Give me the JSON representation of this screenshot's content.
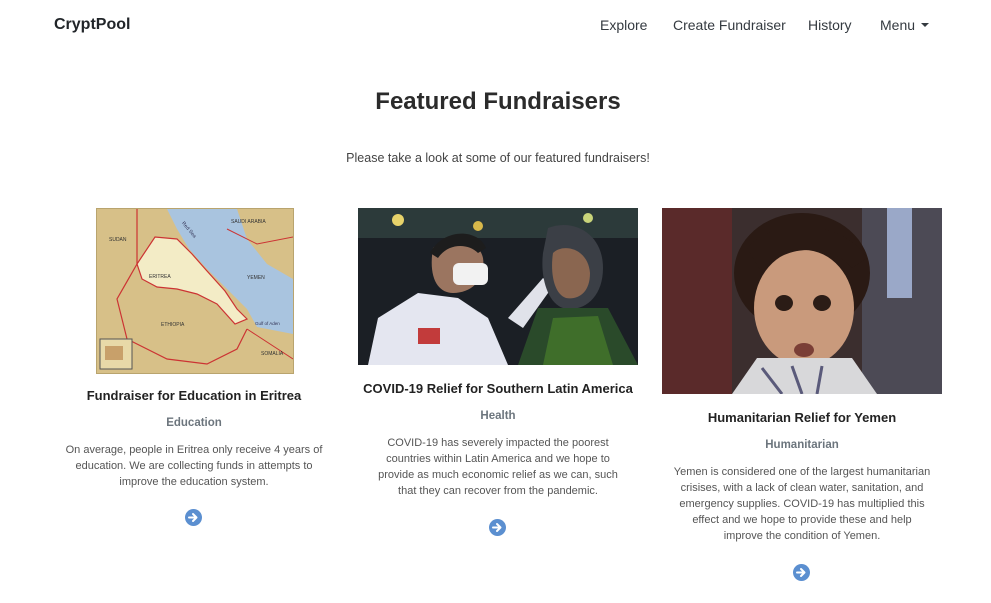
{
  "navbar": {
    "brand": "CryptPool",
    "items": [
      {
        "label": "Explore"
      },
      {
        "label": "Create Fundraiser"
      },
      {
        "label": "History"
      },
      {
        "label": "Menu"
      }
    ]
  },
  "header": {
    "title": "Featured Fundraisers",
    "subtitle": "Please take a look at some of our featured fundraisers!"
  },
  "cards": [
    {
      "image_icon": "eritrea-map-image",
      "map_labels": [
        "SUDAN",
        "ERITREA",
        "SAUDI ARABIA",
        "YEMEN",
        "ETHIOPIA",
        "SOMALIA",
        "Red Sea",
        "Gulf of Aden"
      ],
      "title": "Fundraiser for Education in Eritrea",
      "category": "Education",
      "description_lines": [
        "On average, people in Eritrea only receive 4 years of",
        "education. We are collecting funds in attempts to",
        "improve the education system."
      ],
      "button_icon": "arrow-right-circle-icon"
    },
    {
      "image_icon": "covid-test-photo",
      "title": "COVID-19 Relief for Southern Latin America",
      "category": "Health",
      "description_lines": [
        "COVID-19 has severely impacted the poorest",
        "countries within Latin America and we hope to",
        "provide as much economic relief as we can, such",
        "that they can recover from the pandemic."
      ],
      "button_icon": "arrow-right-circle-icon"
    },
    {
      "image_icon": "yemen-child-photo",
      "title": "Humanitarian Relief for Yemen",
      "category": "Humanitarian",
      "description_lines": [
        "Yemen is considered one of the largest humanitarian",
        "crisises, with a lack of clean water, sanitation, and",
        "emergency supplies. COVID-19 has multiplied this",
        "effect and we hope to provide these and help",
        "improve the condition of Yemen."
      ],
      "button_icon": "arrow-right-circle-icon"
    }
  ],
  "colors": {
    "button": "#5b8fd0",
    "text": "#212529",
    "muted": "#6c757d"
  }
}
